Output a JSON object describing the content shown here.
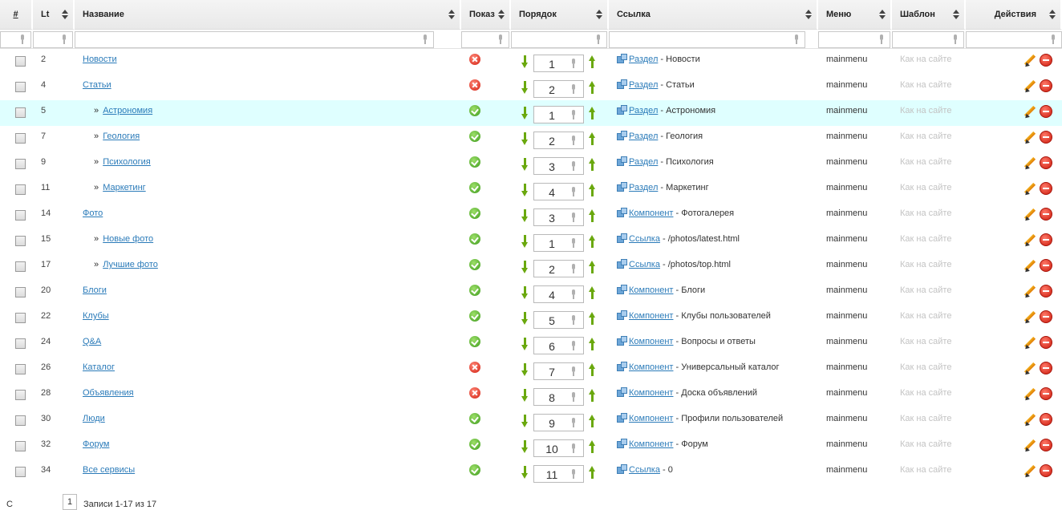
{
  "columns": {
    "num": "#",
    "lt": "Lt",
    "title": "Название",
    "show": "Показ",
    "order": "Порядок",
    "link": "Ссылка",
    "menu": "Меню",
    "template": "Шаблон",
    "actions": "Действия"
  },
  "icons": {
    "sort": "sort-arrows-icon",
    "filter": "microphone-icon",
    "published": "check-green-icon",
    "unpublished": "cross-red-icon",
    "move_down": "arrow-down-green-icon",
    "move_up": "arrow-up-green-icon",
    "link_type": "link-type-icon",
    "edit": "pencil-icon",
    "delete": "delete-red-icon"
  },
  "colors": {
    "link": "#2b7bb9",
    "highlight_row": "#dfffff",
    "published": "#3d9a1c",
    "unpublished": "#d21e10",
    "arrow": "#6aa80e",
    "template_text": "#c3c3c3"
  },
  "rows": [
    {
      "lt": "2",
      "title": "Новости",
      "sub": false,
      "published": false,
      "order": "1",
      "link_type": "Раздел",
      "link_target": " - Новости",
      "menu": "mainmenu",
      "template": "Как на сайте"
    },
    {
      "lt": "4",
      "title": "Статьи",
      "sub": false,
      "published": false,
      "order": "2",
      "link_type": "Раздел",
      "link_target": " - Статьи",
      "menu": "mainmenu",
      "template": "Как на сайте"
    },
    {
      "lt": "5",
      "title": "Астрономия",
      "sub": true,
      "published": true,
      "order": "1",
      "link_type": "Раздел",
      "link_target": " - Астрономия",
      "menu": "mainmenu",
      "template": "Как на сайте",
      "highlight": true
    },
    {
      "lt": "7",
      "title": "Геология",
      "sub": true,
      "published": true,
      "order": "2",
      "link_type": "Раздел",
      "link_target": " - Геология",
      "menu": "mainmenu",
      "template": "Как на сайте"
    },
    {
      "lt": "9",
      "title": "Психология",
      "sub": true,
      "published": true,
      "order": "3",
      "link_type": "Раздел",
      "link_target": " - Психология",
      "menu": "mainmenu",
      "template": "Как на сайте"
    },
    {
      "lt": "11",
      "title": "Маркетинг",
      "sub": true,
      "published": true,
      "order": "4",
      "link_type": "Раздел",
      "link_target": " - Маркетинг",
      "menu": "mainmenu",
      "template": "Как на сайте"
    },
    {
      "lt": "14",
      "title": "Фото",
      "sub": false,
      "published": true,
      "order": "3",
      "link_type": "Компонент",
      "link_target": " - Фотогалерея",
      "menu": "mainmenu",
      "template": "Как на сайте"
    },
    {
      "lt": "15",
      "title": "Новые фото",
      "sub": true,
      "published": true,
      "order": "1",
      "link_type": "Ссылка",
      "link_target": " - /photos/latest.html",
      "menu": "mainmenu",
      "template": "Как на сайте"
    },
    {
      "lt": "17",
      "title": "Лучшие фото",
      "sub": true,
      "published": true,
      "order": "2",
      "link_type": "Ссылка",
      "link_target": " - /photos/top.html",
      "menu": "mainmenu",
      "template": "Как на сайте"
    },
    {
      "lt": "20",
      "title": "Блоги",
      "sub": false,
      "published": true,
      "order": "4",
      "link_type": "Компонент",
      "link_target": " - Блоги",
      "menu": "mainmenu",
      "template": "Как на сайте"
    },
    {
      "lt": "22",
      "title": "Клубы",
      "sub": false,
      "published": true,
      "order": "5",
      "link_type": "Компонент",
      "link_target": " - Клубы пользователей",
      "menu": "mainmenu",
      "template": "Как на сайте"
    },
    {
      "lt": "24",
      "title": "Q&A",
      "sub": false,
      "published": true,
      "order": "6",
      "link_type": "Компонент",
      "link_target": " - Вопросы и ответы",
      "menu": "mainmenu",
      "template": "Как на сайте"
    },
    {
      "lt": "26",
      "title": "Каталог",
      "sub": false,
      "published": false,
      "order": "7",
      "link_type": "Компонент",
      "link_target": " - Универсальный каталог",
      "menu": "mainmenu",
      "template": "Как на сайте"
    },
    {
      "lt": "28",
      "title": "Объявления",
      "sub": false,
      "published": false,
      "order": "8",
      "link_type": "Компонент",
      "link_target": " - Доска объявлений",
      "menu": "mainmenu",
      "template": "Как на сайте"
    },
    {
      "lt": "30",
      "title": "Люди",
      "sub": false,
      "published": true,
      "order": "9",
      "link_type": "Компонент",
      "link_target": " - Профили пользователей",
      "menu": "mainmenu",
      "template": "Как на сайте"
    },
    {
      "lt": "32",
      "title": "Форум",
      "sub": false,
      "published": true,
      "order": "10",
      "link_type": "Компонент",
      "link_target": " - Форум",
      "menu": "mainmenu",
      "template": "Как на сайте"
    },
    {
      "lt": "34",
      "title": "Все сервисы",
      "sub": false,
      "published": true,
      "order": "11",
      "link_type": "Ссылка",
      "link_target": " - 0",
      "menu": "mainmenu",
      "template": "Как на сайте"
    }
  ],
  "pager": {
    "left": "С",
    "current_page": "1",
    "summary": "Записи 1-17 из 17"
  }
}
